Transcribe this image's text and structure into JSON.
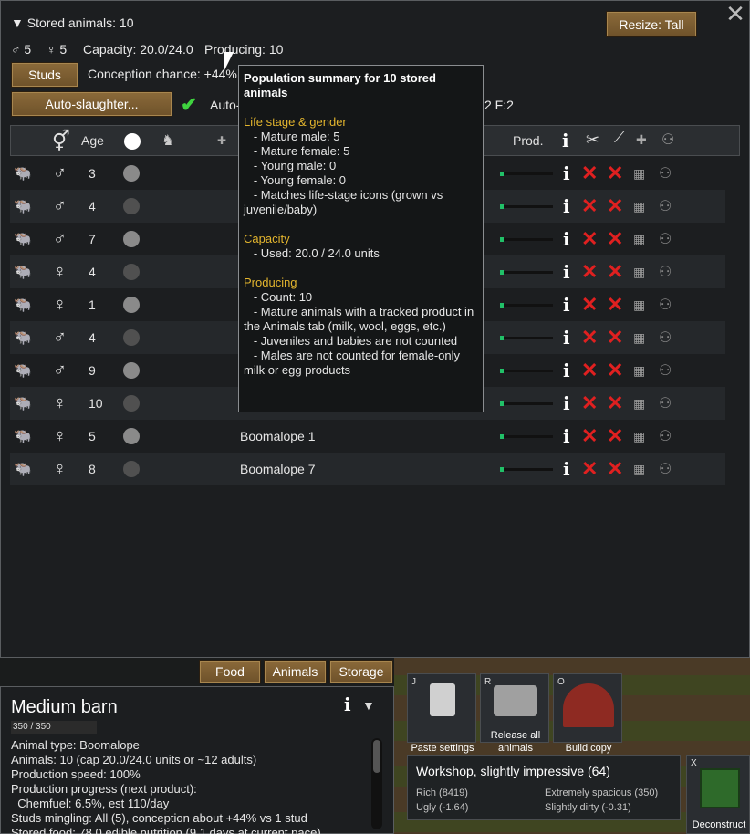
{
  "header": {
    "stored_label": "▼ Stored animals: 10",
    "male_count": "5",
    "female_count": "5",
    "capacity": "Capacity: 20.0/24.0",
    "producing": "Producing: 10",
    "resize_label": "Resize: Tall",
    "studs_label": "Studs",
    "conception": "Conception chance: +44%",
    "auto_slaughter_label": "Auto-slaughter...",
    "auto_label": "Auto-",
    "right_text": "2 F:2"
  },
  "columns": {
    "age": "Age",
    "prod": "Prod."
  },
  "rows": [
    {
      "sex": "♂",
      "age": "3",
      "dot": "#8a8a8a",
      "name": ""
    },
    {
      "sex": "♂",
      "age": "4",
      "dot": "#505050",
      "name": ""
    },
    {
      "sex": "♂",
      "age": "7",
      "dot": "#8a8a8a",
      "name": ""
    },
    {
      "sex": "♀",
      "age": "4",
      "dot": "#505050",
      "name": ""
    },
    {
      "sex": "♀",
      "age": "1",
      "dot": "#8a8a8a",
      "name": ""
    },
    {
      "sex": "♂",
      "age": "4",
      "dot": "#505050",
      "name": ""
    },
    {
      "sex": "♂",
      "age": "9",
      "dot": "#8a8a8a",
      "name": ""
    },
    {
      "sex": "♀",
      "age": "10",
      "dot": "#505050",
      "name": ""
    },
    {
      "sex": "♀",
      "age": "5",
      "dot": "#8a8a8a",
      "name": "Boomalope 1"
    },
    {
      "sex": "♀",
      "age": "8",
      "dot": "#505050",
      "name": "Boomalope 7"
    }
  ],
  "tooltip": {
    "heading": "Population summary for 10 stored animals",
    "sec1": "Life stage & gender",
    "sec1_lines": [
      "   - Mature male: 5",
      "   - Mature female: 5",
      "   - Young male: 0",
      "   - Young female: 0",
      "   - Matches life-stage icons (grown vs juvenile/baby)"
    ],
    "sec2": "Capacity",
    "sec2_lines": [
      "   - Used: 20.0 / 24.0 units"
    ],
    "sec3": "Producing",
    "sec3_lines": [
      "   - Count: 10",
      "   - Mature animals with a tracked product in the Animals tab (milk, wool, eggs, etc.)",
      "   - Juveniles and babies are not counted",
      "   - Males are not counted for female-only milk or egg products"
    ]
  },
  "tabs": [
    "Food",
    "Animals",
    "Storage"
  ],
  "inspect": {
    "title": "Medium barn",
    "hp": "350 / 350",
    "lines": [
      "Animal type: Boomalope",
      "Animals: 10 (cap 20.0/24.0 units or ~12 adults)",
      "Production speed: 100%",
      "Production progress (next product):",
      "  Chemfuel: 6.5%, est 110/day",
      "Studs mingling: All (5), conception about +44% vs 1 stud",
      "Stored food: 78.0 edible nutrition (9.1 days at current pace)"
    ]
  },
  "gizmos": [
    {
      "key": "J",
      "label": "Paste settings"
    },
    {
      "key": "R",
      "label": "Release all animals"
    },
    {
      "key": "O",
      "label": "Build copy"
    }
  ],
  "room": {
    "title": "Workshop, slightly impressive (64)",
    "stats": [
      "Rich (8419)",
      "Extremely spacious (350)",
      "Ugly (-1.64)",
      "Slightly dirty (-0.31)"
    ]
  },
  "deconstruct": {
    "key": "X",
    "label": "Deconstruct"
  },
  "colors": {
    "accent": "#e3b52e",
    "prod_fill": "#21c068",
    "remove": "#e02020",
    "button": "#7b5e32"
  }
}
